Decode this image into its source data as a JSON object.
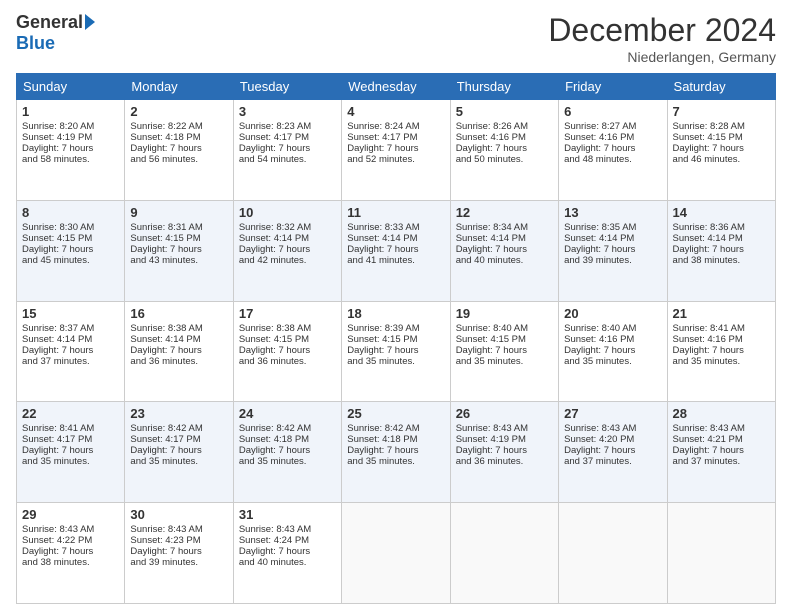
{
  "logo": {
    "general": "General",
    "blue": "Blue"
  },
  "header": {
    "month": "December 2024",
    "location": "Niederlangen, Germany"
  },
  "weekdays": [
    "Sunday",
    "Monday",
    "Tuesday",
    "Wednesday",
    "Thursday",
    "Friday",
    "Saturday"
  ],
  "weeks": [
    [
      {
        "day": "1",
        "lines": [
          "Sunrise: 8:20 AM",
          "Sunset: 4:19 PM",
          "Daylight: 7 hours",
          "and 58 minutes."
        ]
      },
      {
        "day": "2",
        "lines": [
          "Sunrise: 8:22 AM",
          "Sunset: 4:18 PM",
          "Daylight: 7 hours",
          "and 56 minutes."
        ]
      },
      {
        "day": "3",
        "lines": [
          "Sunrise: 8:23 AM",
          "Sunset: 4:17 PM",
          "Daylight: 7 hours",
          "and 54 minutes."
        ]
      },
      {
        "day": "4",
        "lines": [
          "Sunrise: 8:24 AM",
          "Sunset: 4:17 PM",
          "Daylight: 7 hours",
          "and 52 minutes."
        ]
      },
      {
        "day": "5",
        "lines": [
          "Sunrise: 8:26 AM",
          "Sunset: 4:16 PM",
          "Daylight: 7 hours",
          "and 50 minutes."
        ]
      },
      {
        "day": "6",
        "lines": [
          "Sunrise: 8:27 AM",
          "Sunset: 4:16 PM",
          "Daylight: 7 hours",
          "and 48 minutes."
        ]
      },
      {
        "day": "7",
        "lines": [
          "Sunrise: 8:28 AM",
          "Sunset: 4:15 PM",
          "Daylight: 7 hours",
          "and 46 minutes."
        ]
      }
    ],
    [
      {
        "day": "8",
        "lines": [
          "Sunrise: 8:30 AM",
          "Sunset: 4:15 PM",
          "Daylight: 7 hours",
          "and 45 minutes."
        ]
      },
      {
        "day": "9",
        "lines": [
          "Sunrise: 8:31 AM",
          "Sunset: 4:15 PM",
          "Daylight: 7 hours",
          "and 43 minutes."
        ]
      },
      {
        "day": "10",
        "lines": [
          "Sunrise: 8:32 AM",
          "Sunset: 4:14 PM",
          "Daylight: 7 hours",
          "and 42 minutes."
        ]
      },
      {
        "day": "11",
        "lines": [
          "Sunrise: 8:33 AM",
          "Sunset: 4:14 PM",
          "Daylight: 7 hours",
          "and 41 minutes."
        ]
      },
      {
        "day": "12",
        "lines": [
          "Sunrise: 8:34 AM",
          "Sunset: 4:14 PM",
          "Daylight: 7 hours",
          "and 40 minutes."
        ]
      },
      {
        "day": "13",
        "lines": [
          "Sunrise: 8:35 AM",
          "Sunset: 4:14 PM",
          "Daylight: 7 hours",
          "and 39 minutes."
        ]
      },
      {
        "day": "14",
        "lines": [
          "Sunrise: 8:36 AM",
          "Sunset: 4:14 PM",
          "Daylight: 7 hours",
          "and 38 minutes."
        ]
      }
    ],
    [
      {
        "day": "15",
        "lines": [
          "Sunrise: 8:37 AM",
          "Sunset: 4:14 PM",
          "Daylight: 7 hours",
          "and 37 minutes."
        ]
      },
      {
        "day": "16",
        "lines": [
          "Sunrise: 8:38 AM",
          "Sunset: 4:14 PM",
          "Daylight: 7 hours",
          "and 36 minutes."
        ]
      },
      {
        "day": "17",
        "lines": [
          "Sunrise: 8:38 AM",
          "Sunset: 4:15 PM",
          "Daylight: 7 hours",
          "and 36 minutes."
        ]
      },
      {
        "day": "18",
        "lines": [
          "Sunrise: 8:39 AM",
          "Sunset: 4:15 PM",
          "Daylight: 7 hours",
          "and 35 minutes."
        ]
      },
      {
        "day": "19",
        "lines": [
          "Sunrise: 8:40 AM",
          "Sunset: 4:15 PM",
          "Daylight: 7 hours",
          "and 35 minutes."
        ]
      },
      {
        "day": "20",
        "lines": [
          "Sunrise: 8:40 AM",
          "Sunset: 4:16 PM",
          "Daylight: 7 hours",
          "and 35 minutes."
        ]
      },
      {
        "day": "21",
        "lines": [
          "Sunrise: 8:41 AM",
          "Sunset: 4:16 PM",
          "Daylight: 7 hours",
          "and 35 minutes."
        ]
      }
    ],
    [
      {
        "day": "22",
        "lines": [
          "Sunrise: 8:41 AM",
          "Sunset: 4:17 PM",
          "Daylight: 7 hours",
          "and 35 minutes."
        ]
      },
      {
        "day": "23",
        "lines": [
          "Sunrise: 8:42 AM",
          "Sunset: 4:17 PM",
          "Daylight: 7 hours",
          "and 35 minutes."
        ]
      },
      {
        "day": "24",
        "lines": [
          "Sunrise: 8:42 AM",
          "Sunset: 4:18 PM",
          "Daylight: 7 hours",
          "and 35 minutes."
        ]
      },
      {
        "day": "25",
        "lines": [
          "Sunrise: 8:42 AM",
          "Sunset: 4:18 PM",
          "Daylight: 7 hours",
          "and 35 minutes."
        ]
      },
      {
        "day": "26",
        "lines": [
          "Sunrise: 8:43 AM",
          "Sunset: 4:19 PM",
          "Daylight: 7 hours",
          "and 36 minutes."
        ]
      },
      {
        "day": "27",
        "lines": [
          "Sunrise: 8:43 AM",
          "Sunset: 4:20 PM",
          "Daylight: 7 hours",
          "and 37 minutes."
        ]
      },
      {
        "day": "28",
        "lines": [
          "Sunrise: 8:43 AM",
          "Sunset: 4:21 PM",
          "Daylight: 7 hours",
          "and 37 minutes."
        ]
      }
    ],
    [
      {
        "day": "29",
        "lines": [
          "Sunrise: 8:43 AM",
          "Sunset: 4:22 PM",
          "Daylight: 7 hours",
          "and 38 minutes."
        ]
      },
      {
        "day": "30",
        "lines": [
          "Sunrise: 8:43 AM",
          "Sunset: 4:23 PM",
          "Daylight: 7 hours",
          "and 39 minutes."
        ]
      },
      {
        "day": "31",
        "lines": [
          "Sunrise: 8:43 AM",
          "Sunset: 4:24 PM",
          "Daylight: 7 hours",
          "and 40 minutes."
        ]
      },
      {
        "day": "",
        "lines": []
      },
      {
        "day": "",
        "lines": []
      },
      {
        "day": "",
        "lines": []
      },
      {
        "day": "",
        "lines": []
      }
    ]
  ]
}
